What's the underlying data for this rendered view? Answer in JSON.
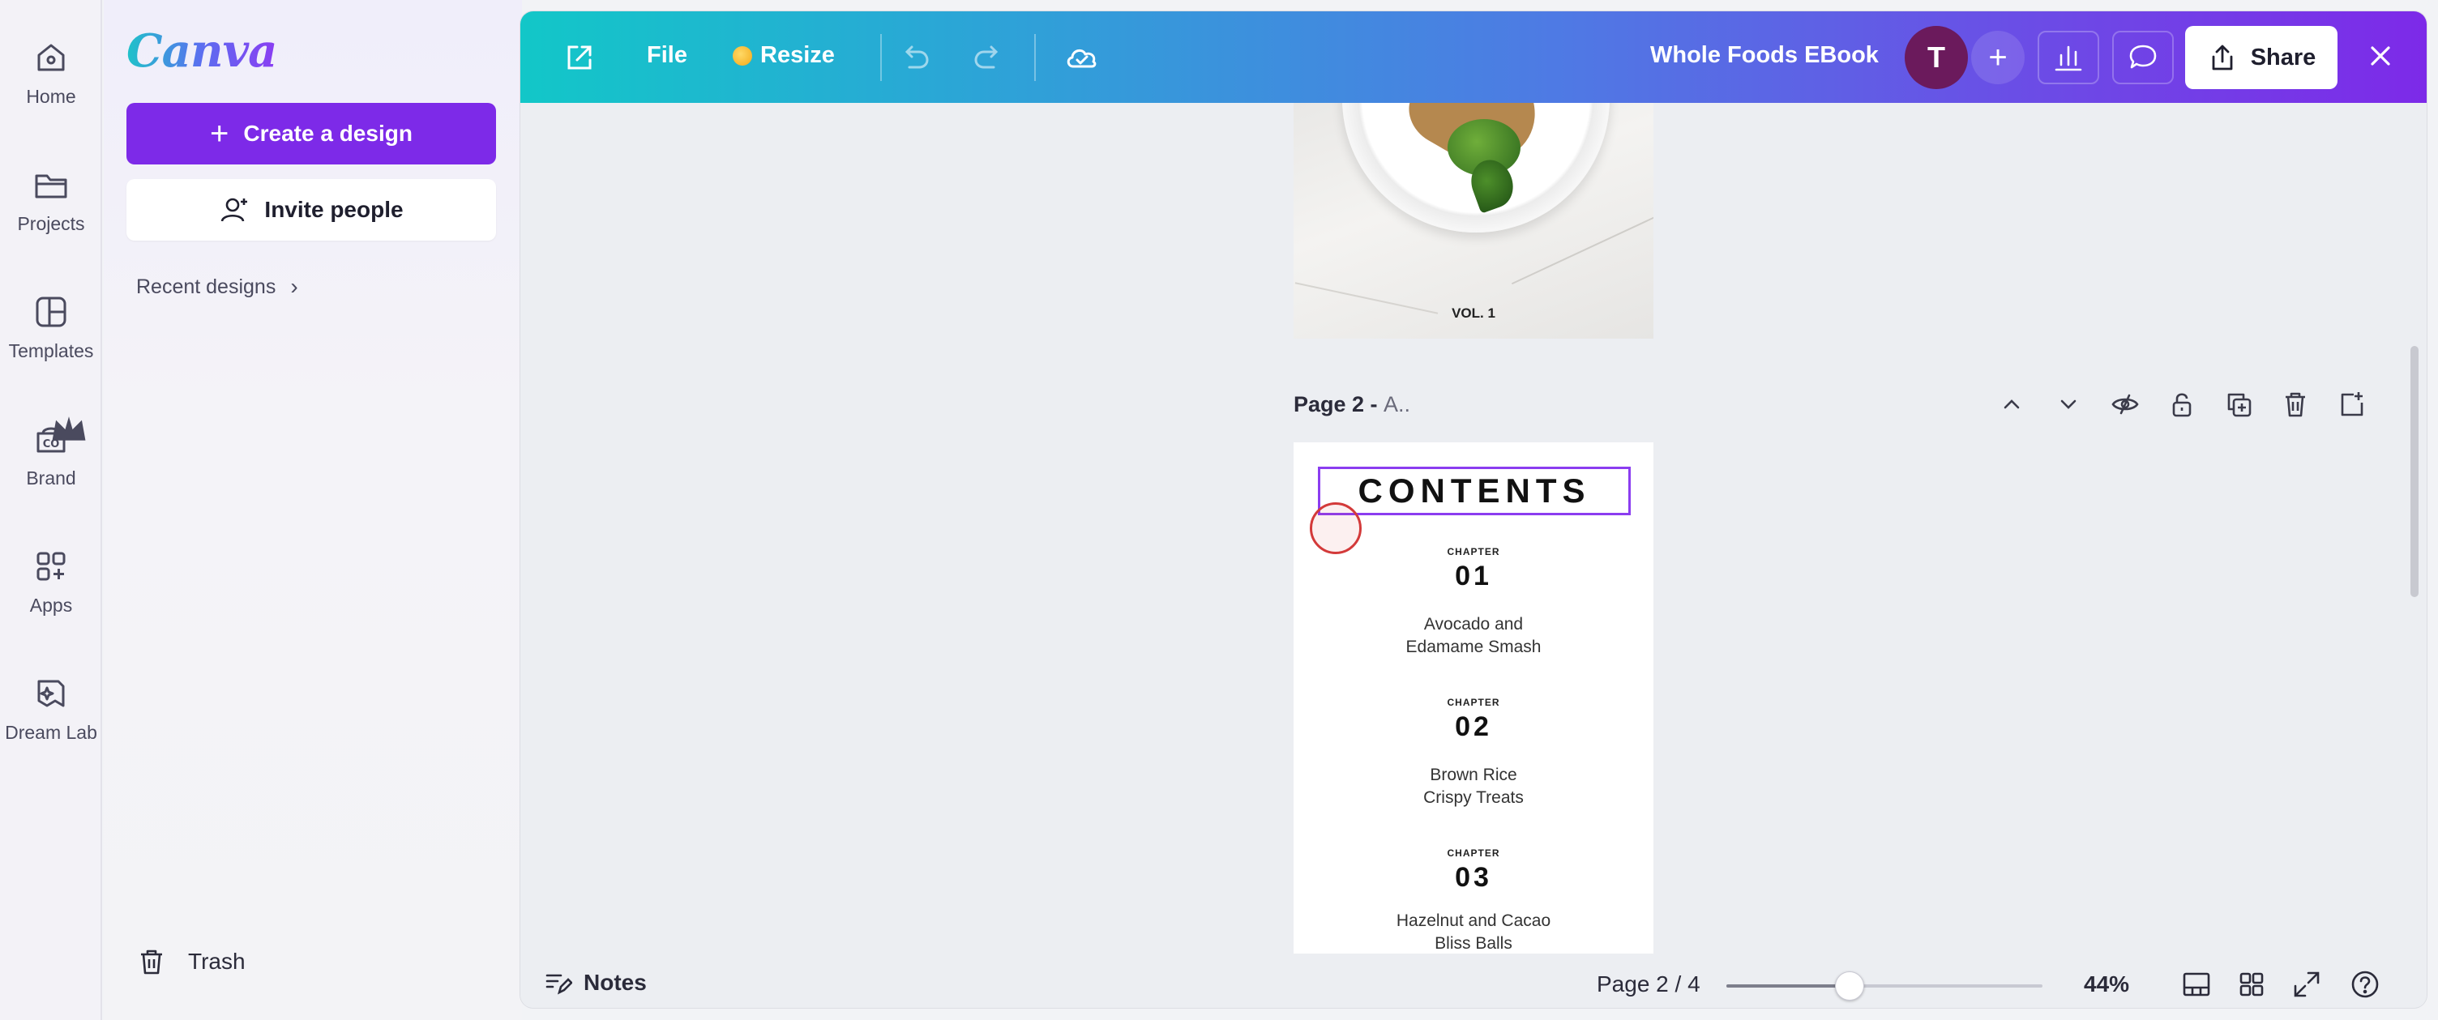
{
  "rail": {
    "items": [
      {
        "label": "Home",
        "icon": "home-icon"
      },
      {
        "label": "Projects",
        "icon": "folder-icon"
      },
      {
        "label": "Templates",
        "icon": "templates-icon"
      },
      {
        "label": "Brand",
        "icon": "brand-icon"
      },
      {
        "label": "Apps",
        "icon": "apps-icon"
      },
      {
        "label": "Dream Lab",
        "icon": "dream-lab-icon"
      }
    ]
  },
  "panel": {
    "logo": "Canva",
    "create_label": "Create a design",
    "invite_label": "Invite people",
    "recent_label": "Recent designs",
    "trash_label": "Trash"
  },
  "topbar": {
    "file_label": "File",
    "resize_label": "Resize",
    "title": "Whole Foods EBook",
    "avatar_initial": "T",
    "share_label": "Share"
  },
  "canvas": {
    "page1_caption": "VOL. 1",
    "page_label": "Page 2 - ",
    "page_label_dim": "A..",
    "contents_title": "CONTENTS",
    "chapters": [
      {
        "kicker": "CHAPTER",
        "number": "01",
        "line1": "Avocado and",
        "line2": "Edamame Smash"
      },
      {
        "kicker": "CHAPTER",
        "number": "02",
        "line1": "Brown Rice",
        "line2": "Crispy Treats"
      },
      {
        "kicker": "CHAPTER",
        "number": "03",
        "line1": "Hazelnut and Cacao",
        "line2": "Bliss Balls"
      }
    ]
  },
  "bottombar": {
    "notes_label": "Notes",
    "page_indicator": "Page 2 / 4",
    "zoom_label": "44%",
    "zoom_slider_fraction": 0.39
  },
  "colors": {
    "brand_purple": "#7d2ae8",
    "topbar_start": "#12c7c8",
    "topbar_end": "#7d2ae8",
    "selection": "#8b3df0"
  }
}
